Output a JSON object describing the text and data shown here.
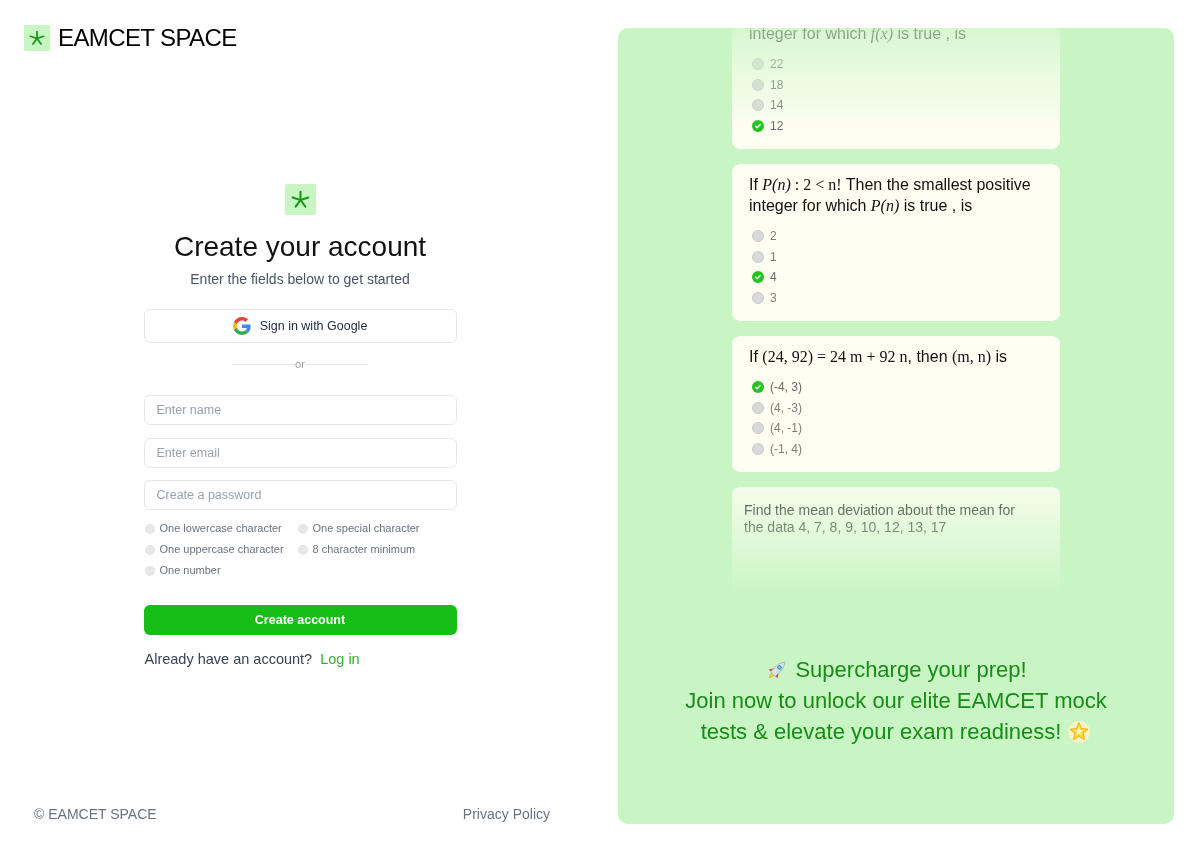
{
  "brand": {
    "name": "EAMCET SPACE"
  },
  "signup": {
    "title": "Create your account",
    "subtitle": "Enter the fields below to get started",
    "google_button": "Sign in with Google",
    "divider": "or",
    "fields": [
      {
        "placeholder": "Enter name"
      },
      {
        "placeholder": "Enter email"
      },
      {
        "placeholder": "Create a password"
      }
    ],
    "password_rules": [
      {
        "label": "One lowercase character",
        "met": false
      },
      {
        "label": "One special character",
        "met": false
      },
      {
        "label": "One uppercase character",
        "met": false
      },
      {
        "label": "8 character minimum",
        "met": false
      },
      {
        "label": "One number",
        "met": false
      }
    ],
    "submit_button": "Create account",
    "login_prompt": {
      "text": "Already have an account?",
      "link": "Log in"
    }
  },
  "footer": {
    "copyright": "© EAMCET SPACE",
    "link": "Privacy Policy"
  },
  "preview": {
    "questions": [
      {
        "kind": "formula",
        "question": [
          {
            "kind": "text",
            "text": "integer for which "
          },
          {
            "kind": "math",
            "text": "*f(x)*"
          },
          {
            "kind": "text",
            "text": " is true , is"
          }
        ],
        "options": [
          {
            "label": "22",
            "selected": false
          },
          {
            "label": "18",
            "selected": false
          },
          {
            "label": "14",
            "selected": false
          },
          {
            "label": "12",
            "selected": true
          }
        ]
      },
      {
        "kind": "formula",
        "question": [
          {
            "kind": "text",
            "text": "If "
          },
          {
            "kind": "math",
            "text": "*P(n)* : 2 < n!"
          },
          {
            "kind": "text",
            "text": " Then the smallest positive integer for which "
          },
          {
            "kind": "math",
            "text": "*P(n)*"
          },
          {
            "kind": "text",
            "text": " is true , is"
          }
        ],
        "options": [
          {
            "label": "2",
            "selected": false
          },
          {
            "label": "1",
            "selected": false
          },
          {
            "label": "4",
            "selected": true
          },
          {
            "label": "3",
            "selected": false
          }
        ]
      },
      {
        "kind": "formula",
        "question": [
          {
            "kind": "text",
            "text": "If "
          },
          {
            "kind": "math",
            "text": "(24, 92) = 24 m + 92 n"
          },
          {
            "kind": "text",
            "text": ", then "
          },
          {
            "kind": "math",
            "text": "(m, n)"
          },
          {
            "kind": "text",
            "text": " is"
          }
        ],
        "options": [
          {
            "label": "(-4, 3)",
            "selected": true
          },
          {
            "label": "(4, -3)",
            "selected": false
          },
          {
            "label": "(4, -1)",
            "selected": false
          },
          {
            "label": "(-1, 4)",
            "selected": false
          }
        ]
      },
      {
        "kind": "plain",
        "question": "Find the mean deviation about the mean for the data 4, 7, 8, 9, 10, 12, 13, 17"
      }
    ],
    "promo": {
      "headline": "Supercharge your prep!",
      "body_lines": [
        "Join now to unlock our elite EAMCET mock",
        "tests & elevate your exam readiness!"
      ]
    }
  }
}
